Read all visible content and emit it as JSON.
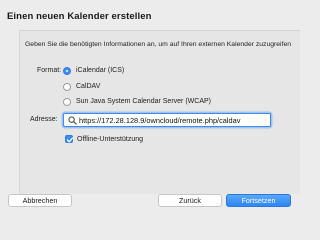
{
  "dialog": {
    "title": "Einen neuen Kalender erstellen",
    "description": "Geben Sie die benötigten Informationen an, um auf Ihren externen Kalender zuzugreifen"
  },
  "format": {
    "label": "Format:",
    "options": [
      {
        "label": "iCalendar (ICS)",
        "selected": true
      },
      {
        "label": "CalDAV",
        "selected": false
      },
      {
        "label": "Sun Java System Calendar Server (WCAP)",
        "selected": false
      }
    ]
  },
  "address": {
    "label": "Adresse:",
    "value": "https://172.28.128.9/owncloud/remote.php/caldav"
  },
  "offline": {
    "label": "Offline-Unterstützung",
    "checked": true
  },
  "buttons": {
    "cancel": "Abbrechen",
    "back": "Zurück",
    "continue": "Fortsetzen"
  },
  "colors": {
    "accent": "#3b8cf2",
    "background": "#ececec"
  }
}
